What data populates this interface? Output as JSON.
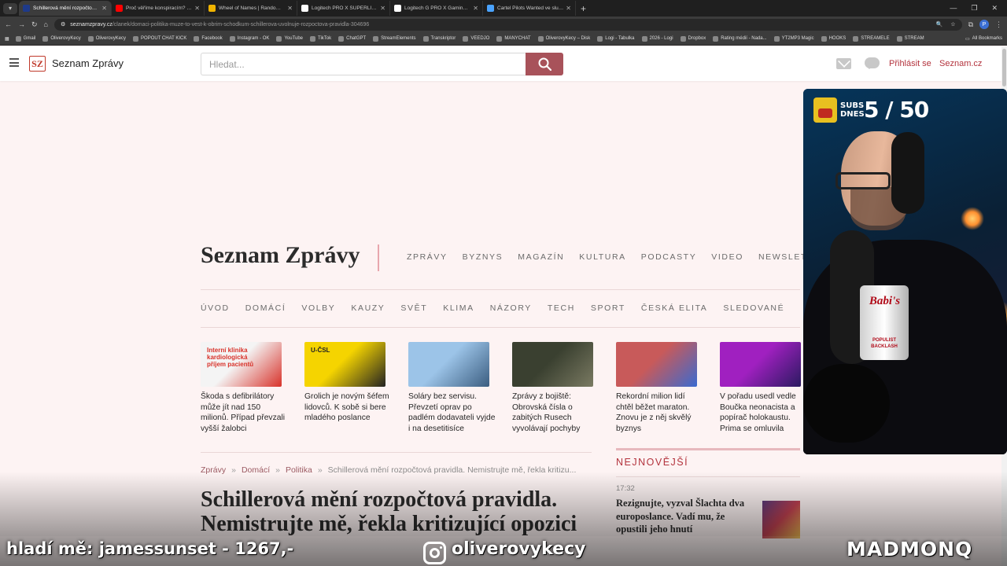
{
  "browser": {
    "tabs": [
      {
        "title": "Schillerová mění rozpočtová pravidla",
        "active": true,
        "color": "#1e3a8a"
      },
      {
        "title": "Proč věříme konspiracím? | Wh",
        "active": false,
        "color": "#ff0000"
      },
      {
        "title": "Wheel of Names | Random nam",
        "active": false,
        "color": "#f0b400"
      },
      {
        "title": "Logitech PRO X SUPERLIGHT 2",
        "active": false,
        "color": "#ffffff"
      },
      {
        "title": "Logitech G PRO X Gaming Hea",
        "active": false,
        "color": "#ffffff"
      },
      {
        "title": "Cartel Pilots Wanted ve službě",
        "active": false,
        "color": "#4aa3ff"
      }
    ],
    "url_host": "seznamzpravy.cz",
    "url_path": "/clanek/domaci-politika-muze-to-vest-k-obrim-schodkum-schillerova-uvolnuje-rozpoctova-pravidla-304696",
    "bookmarks": [
      "Gmail",
      "OliverovyKecy",
      "OliverovyKecy",
      "POPOUT CHAT KICK",
      "Facebook",
      "Instagram - OK",
      "YouTube",
      "TikTok",
      "ChatGPT",
      "StreamElements",
      "Transkriptor",
      "VEEDJO",
      "MANYCHAT",
      "OliverovyKecy – Disk",
      "Logi - Tabulka",
      "2026 - Logi",
      "Dropbox",
      "Rating médií - Nada...",
      "YT2MP3 Magic",
      "HOOKS",
      "STREAMELE",
      "STREAM"
    ],
    "all_bookmarks": "All Bookmarks"
  },
  "header": {
    "logo": "SZ",
    "site_title": "Seznam Zprávy",
    "search_placeholder": "Hledat...",
    "login": "Přihlásit se",
    "seznam": "Seznam.cz"
  },
  "brand": "Seznam Zprávy",
  "topnav": [
    "ZPRÁVY",
    "BYZNYS",
    "MAGAZÍN",
    "KULTURA",
    "PODCASTY",
    "VIDEO",
    "NEWSLETTERY"
  ],
  "subnav": [
    "ÚVOD",
    "DOMÁCÍ",
    "VOLBY",
    "KAUZY",
    "SVĚT",
    "KLIMA",
    "NÁZORY",
    "TECH",
    "SPORT",
    "ČESKÁ ELITA",
    "SLEDOVANÉ"
  ],
  "cards": [
    {
      "caption": "Škoda s defibrilátory může jít nad 150 milionů. Případ převzali vyšší žalobci",
      "thumb_text": "Interní klinika kardiologická příjem pacientů",
      "colors": [
        "#f4f4f4",
        "#d8322a"
      ]
    },
    {
      "caption": "Grolich je novým šéfem lidovců. K sobě si bere mladého poslance",
      "thumb_text": "U-ČSL",
      "colors": [
        "#f5d400",
        "#222222"
      ]
    },
    {
      "caption": "Soláry bez servisu. Převzetí oprav po padlém dodavateli vyjde i na desetitisíce",
      "thumb_text": "",
      "colors": [
        "#9cc4e8",
        "#3b5d80"
      ]
    },
    {
      "caption": "Zprávy z bojiště: Obrovská čísla o zabitých Rusech vyvolávají pochyby",
      "thumb_text": "",
      "colors": [
        "#3a4030",
        "#7a7a62"
      ]
    },
    {
      "caption": "Rekordní milion lidí chtěl běžet maraton. Znovu je z něj skvělý byznys",
      "thumb_text": "",
      "colors": [
        "#c85a5a",
        "#3a6ad0"
      ]
    },
    {
      "caption": "V pořadu usedl vedle Boučka neonacista a popírač holokaustu. Prima se omluvila",
      "thumb_text": "",
      "colors": [
        "#a020c0",
        "#2a1a60"
      ]
    }
  ],
  "breadcrumb": {
    "items": [
      "Zprávy",
      "Domácí",
      "Politika"
    ],
    "current": "Schillerová mění rozpočtová pravidla. Nemistrujte mě, řekla kritizu...",
    "separator": "»"
  },
  "headline": "Schillerová mění rozpočtová pravidla. Nemistrujte mě, řekla kritizující opozici",
  "newest": {
    "title": "NEJNOVĚJŠÍ",
    "time": "17:32",
    "text": "Rezignujte, vyzval Šlachta dva europoslance. Vadí mu, že opustili jeho hnutí"
  },
  "stream": {
    "subs_label": "SUBS DNES",
    "subs_count": "5 / 50",
    "ticker": "hladí mě: jamessunset - 1267,-",
    "instagram": "oliverovykecy",
    "channel": "MADMONQ",
    "can_brand": "Babi's",
    "can_text": "POPULIST BACKLASH"
  }
}
